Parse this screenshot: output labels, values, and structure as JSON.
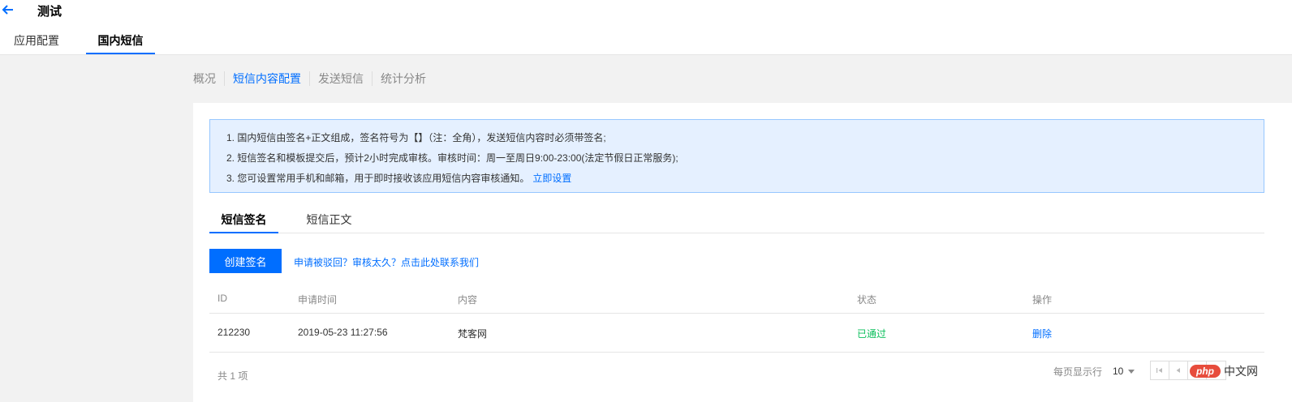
{
  "header": {
    "title": "测试",
    "tabs": [
      {
        "label": "应用配置",
        "active": false
      },
      {
        "label": "国内短信",
        "active": true
      }
    ]
  },
  "subnav": [
    {
      "label": "概况",
      "active": false
    },
    {
      "label": "短信内容配置",
      "active": true
    },
    {
      "label": "发送短信",
      "active": false
    },
    {
      "label": "统计分析",
      "active": false
    }
  ],
  "notice": {
    "line1": "1. 国内短信由签名+正文组成，签名符号为【】（注：全角），发送短信内容时必须带签名;",
    "line2": "2. 短信签名和模板提交后，预计2小时完成审核。审核时间：周一至周日9:00-23:00(法定节假日正常服务);",
    "line3": "3. 您可设置常用手机和邮箱，用于即时接收该应用短信内容审核通知。",
    "line3_link": "立即设置"
  },
  "inner_tabs": [
    {
      "label": "短信签名",
      "active": true
    },
    {
      "label": "短信正文",
      "active": false
    }
  ],
  "actions": {
    "create_label": "创建签名",
    "help_link": "申请被驳回？审核太久？点击此处联系我们"
  },
  "table": {
    "columns": {
      "id": "ID",
      "time": "申请时间",
      "content": "内容",
      "status": "状态",
      "action": "操作"
    },
    "rows": [
      {
        "id": "212230",
        "time": "2019-05-23 11:27:56",
        "content": "梵客网",
        "status": "已通过",
        "action": "删除"
      }
    ]
  },
  "footer": {
    "total": "共 1 项",
    "per_page_label": "每页显示行",
    "per_page_value": "10"
  },
  "watermark": {
    "badge": "php",
    "text": "中文网"
  },
  "colors": {
    "accent": "#006eff",
    "success": "#0abf5b",
    "notice_bg": "#e5f0ff"
  }
}
